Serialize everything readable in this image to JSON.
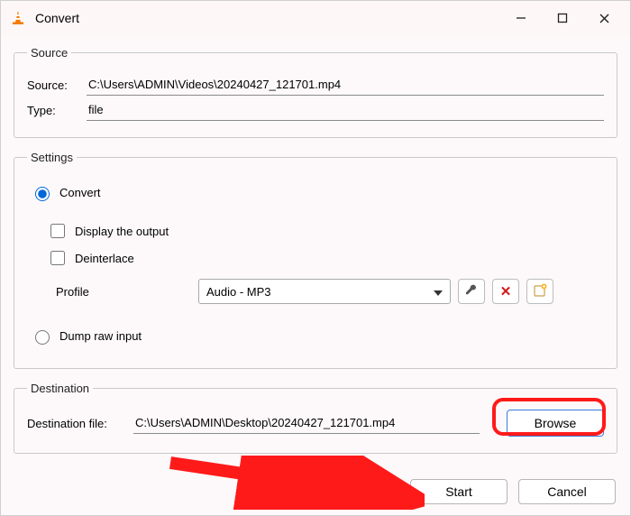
{
  "window": {
    "title": "Convert"
  },
  "source_group": {
    "legend": "Source",
    "source_label": "Source:",
    "source_value": "C:\\Users\\ADMIN\\Videos\\20240427_121701.mp4",
    "type_label": "Type:",
    "type_value": "file"
  },
  "settings_group": {
    "legend": "Settings",
    "convert_label": "Convert",
    "display_output_label": "Display the output",
    "deinterlace_label": "Deinterlace",
    "profile_label": "Profile",
    "profile_value": "Audio - MP3",
    "dump_raw_label": "Dump raw input"
  },
  "destination_group": {
    "legend": "Destination",
    "dest_file_label": "Destination file:",
    "dest_file_value": "C:\\Users\\ADMIN\\Desktop\\20240427_121701.mp4",
    "browse_label": "Browse"
  },
  "footer": {
    "start_label": "Start",
    "cancel_label": "Cancel"
  }
}
